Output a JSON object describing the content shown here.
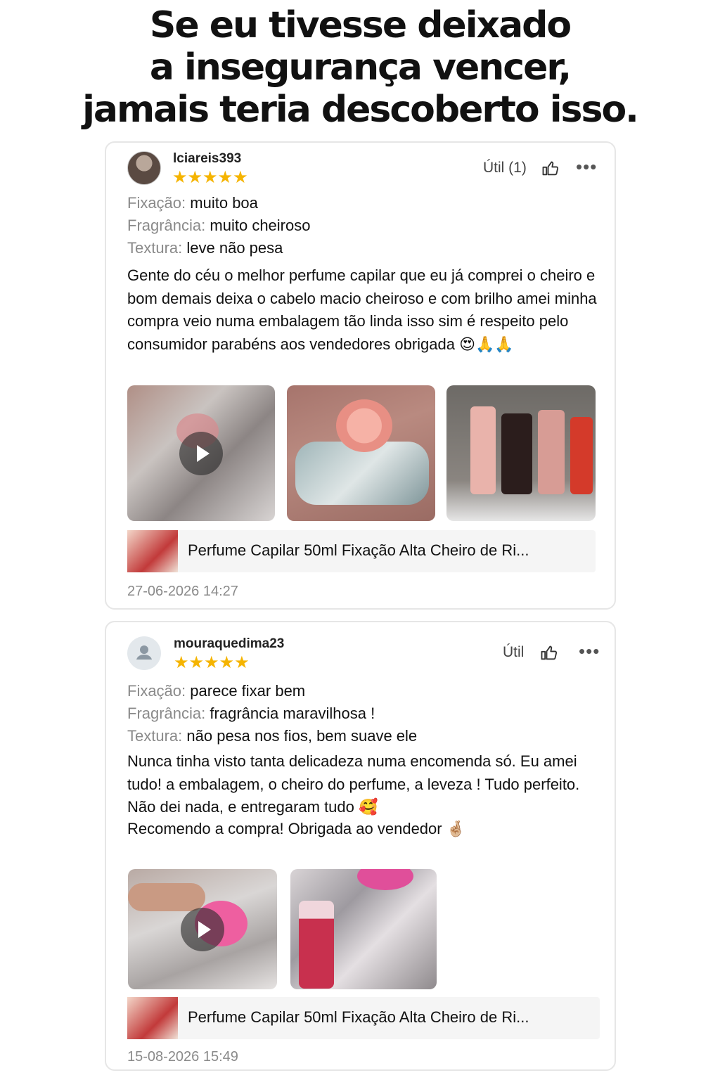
{
  "headline": {
    "line1": "Se eu tivesse deixado",
    "line2": "a insegurança vencer,",
    "line3": "jamais teria descoberto isso."
  },
  "reviews": [
    {
      "username": "lciareis393",
      "stars": "★★★★★",
      "rating": 5,
      "util_label": "Útil (1)",
      "more": "•••",
      "attributes": [
        {
          "label": "Fixação:",
          "value": "muito boa"
        },
        {
          "label": "Fragrância:",
          "value": "muito cheiroso"
        },
        {
          "label": "Textura:",
          "value": "leve não pesa"
        }
      ],
      "body": "Gente do céu o melhor perfume capilar que eu já comprei o cheiro e bom demais deixa o cabelo macio cheiroso e com brilho amei minha compra veio numa embalagem tão linda isso sim é respeito pelo consumidor parabéns aos vendedores obrigada  😍🙏🙏",
      "media": [
        {
          "type": "video",
          "icon": "play-icon"
        },
        {
          "type": "photo"
        },
        {
          "type": "photo"
        }
      ],
      "product_name": "Perfume Capilar 50ml Fixação Alta Cheiro de Ri...",
      "date": "27-06-2026 14:27"
    },
    {
      "username": "mouraquedima23",
      "stars": "★★★★★",
      "rating": 5,
      "util_label": "Útil",
      "more": "•••",
      "attributes": [
        {
          "label": "Fixação:",
          "value": "parece fixar bem"
        },
        {
          "label": "Fragrância:",
          "value": "fragrância maravilhosa !"
        },
        {
          "label": "Textura:",
          "value": "não pesa nos fios, bem suave ele"
        }
      ],
      "body_line1": "Nunca tinha visto tanta delicadeza numa encomenda só. Eu amei tudo! a embalagem, o cheiro do perfume, a leveza ! Tudo perfeito. Não dei nada, e entregaram tudo 🥰",
      "body_line2": "Recomendo a compra! Obrigada ao vendedor 🤞🏼",
      "media": [
        {
          "type": "video",
          "icon": "play-icon"
        },
        {
          "type": "photo"
        }
      ],
      "product_name": "Perfume Capilar 50ml Fixação Alta Cheiro de Ri...",
      "date": "15-08-2026 15:49"
    }
  ],
  "colors": {
    "star": "#f5b400",
    "label_gray": "#8a8a8a",
    "card_border": "#e6e6e6"
  }
}
